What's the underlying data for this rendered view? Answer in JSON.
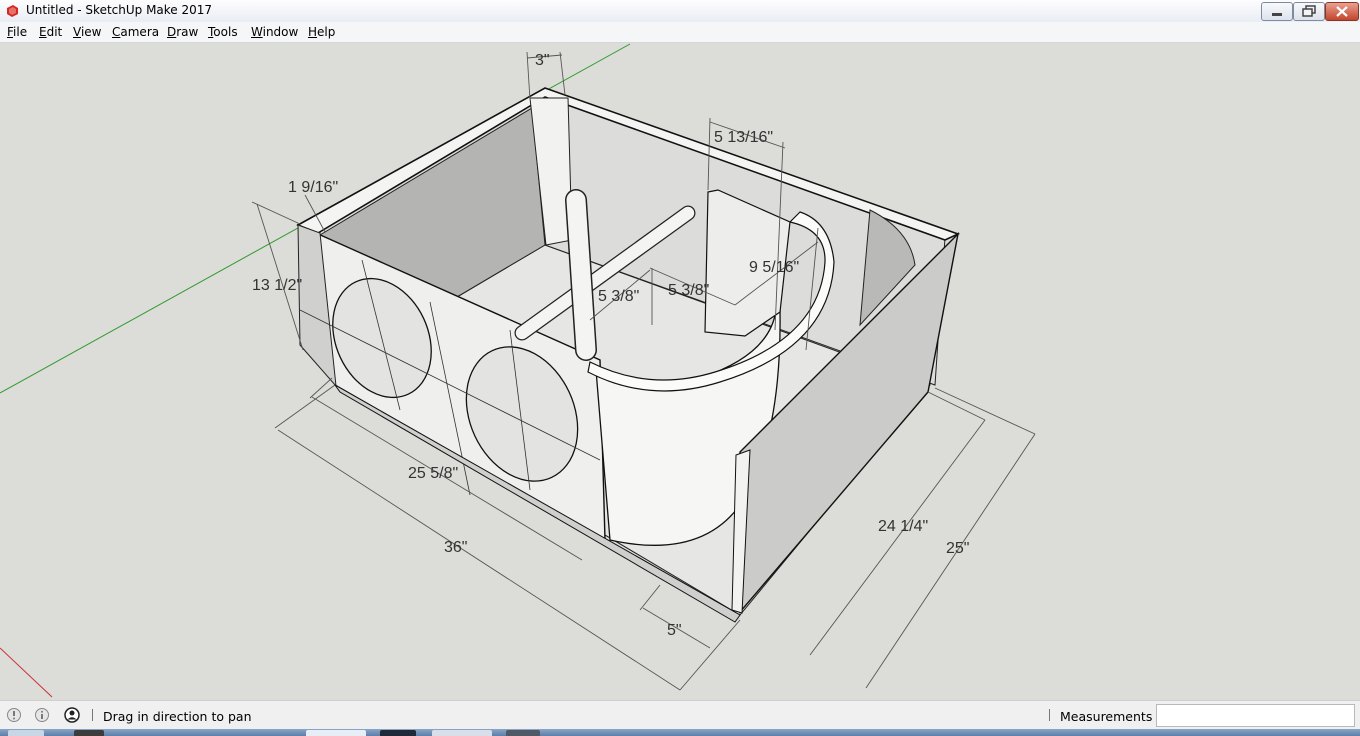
{
  "window": {
    "title": "Untitled - SketchUp Make 2017",
    "colors": {
      "close_button": "#c3452d",
      "titlebar": "#e9edf4"
    }
  },
  "menu": {
    "items": [
      {
        "label": "File",
        "hot": "F",
        "rest": "ile"
      },
      {
        "label": "Edit",
        "hot": "E",
        "rest": "dit"
      },
      {
        "label": "View",
        "hot": "V",
        "rest": "iew"
      },
      {
        "label": "Camera",
        "hot": "C",
        "rest": "amera"
      },
      {
        "label": "Draw",
        "hot": "D",
        "rest": "raw"
      },
      {
        "label": "Tools",
        "hot": "T",
        "rest": "ools"
      },
      {
        "label": "Window",
        "hot": "W",
        "rest": "indow"
      },
      {
        "label": "Help",
        "hot": "H",
        "rest": "elp"
      }
    ]
  },
  "model": {
    "dimensions": [
      "3\"",
      "5 13/16\"",
      "1 9/16\"",
      "13 1/2\"",
      "9 5/16\"",
      "5 3/8\"",
      "5 3/8\"",
      "25 5/8\"",
      "36\"",
      "24 1/4\"",
      "25\"",
      "5\""
    ],
    "axis_colors": {
      "green_axis": "#2e9a2e",
      "red_axis": "#c83232"
    }
  },
  "status": {
    "hint": "Drag in direction to pan",
    "measurements_label": "Measurements",
    "measurements_value": "",
    "icons": [
      "geo-location-icon",
      "credits-icon",
      "user-account-icon"
    ]
  }
}
